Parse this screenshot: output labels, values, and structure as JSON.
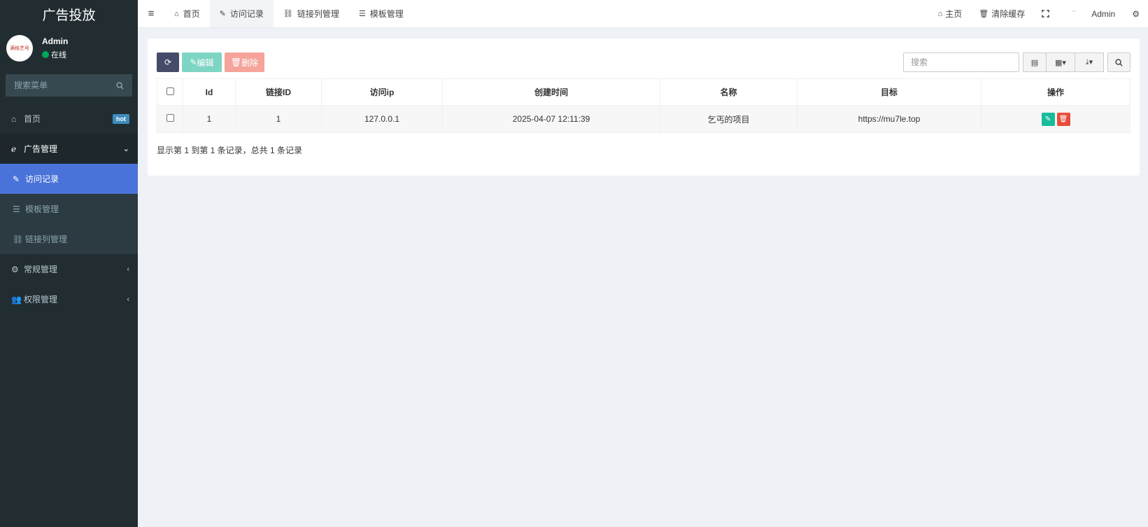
{
  "brand": "广告投放",
  "user": {
    "name": "Admin",
    "status": "在线",
    "avatar_text": "满格艺号"
  },
  "sidebar": {
    "search_placeholder": "搜索菜单",
    "items": [
      {
        "icon": "home-icon",
        "glyph": "⌂",
        "label": "首页",
        "badge": "hot"
      },
      {
        "icon": "ie-icon",
        "glyph": "ℯ",
        "label": "广告管理",
        "chevron": "⌄",
        "children": [
          {
            "icon": "pencil-icon",
            "glyph": "✎",
            "label": "访问记录",
            "active": true
          },
          {
            "icon": "list-icon",
            "glyph": "☰",
            "label": "模板管理"
          },
          {
            "icon": "chain-icon",
            "glyph": "⛓",
            "label": "链接列管理"
          }
        ]
      },
      {
        "icon": "cogs-icon",
        "glyph": "⚙",
        "label": "常规管理",
        "chevron": "‹"
      },
      {
        "icon": "users-icon",
        "glyph": "👥",
        "label": "权限管理",
        "chevron": "‹"
      }
    ]
  },
  "topbar": {
    "tabs": [
      {
        "icon": "home-icon",
        "glyph": "⌂",
        "label": "首页"
      },
      {
        "icon": "pencil-icon",
        "glyph": "✎",
        "label": "访问记录",
        "active": true
      },
      {
        "icon": "chain-icon",
        "glyph": "⛓",
        "label": "链接列管理"
      },
      {
        "icon": "list-icon",
        "glyph": "☰",
        "label": "模板管理"
      }
    ],
    "home_label": "主页",
    "clear_cache_label": "清除缓存",
    "user_name": "Admin"
  },
  "toolbar": {
    "edit_label": "编辑",
    "delete_label": "删除",
    "search_placeholder": "搜索"
  },
  "table": {
    "columns": [
      "Id",
      "链接ID",
      "访问ip",
      "创建时间",
      "名称",
      "目标",
      "操作"
    ],
    "rows": [
      {
        "id": "1",
        "link_id": "1",
        "ip": "127.0.0.1",
        "created": "2025-04-07 12:11:39",
        "name": "乞丐的项目",
        "target": "https://mu7le.top"
      }
    ]
  },
  "pagination_info": "显示第 1 到第 1 条记录，总共 1 条记录",
  "colors": {
    "sidebar_bg": "#222d32",
    "active_menu": "#4a73d9",
    "edit_green": "#18bc9c",
    "delete_red": "#e74c3c",
    "refresh_btn": "#444c69"
  }
}
